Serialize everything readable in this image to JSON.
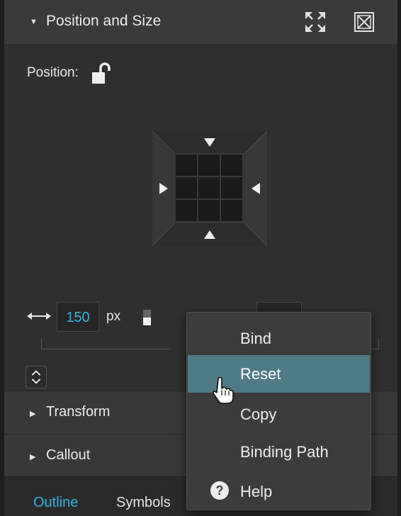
{
  "header": {
    "title": "Position and Size"
  },
  "position": {
    "label": "Position:"
  },
  "width": {
    "value": "150",
    "unit": "px"
  },
  "sections": [
    {
      "label": "Transform"
    },
    {
      "label": "Callout"
    }
  ],
  "tabs": [
    {
      "label": "Outline",
      "active": true
    },
    {
      "label": "Symbols",
      "active": false
    }
  ],
  "context_menu": {
    "items": [
      {
        "label": "Bind"
      },
      {
        "label": "Reset",
        "highlighted": true
      },
      {
        "label": "Copy"
      },
      {
        "label": "Binding Path"
      },
      {
        "label": "Help",
        "icon": "question-circle-icon"
      }
    ]
  },
  "colors": {
    "accent": "#33b5e5",
    "highlight": "#4e7b87"
  }
}
